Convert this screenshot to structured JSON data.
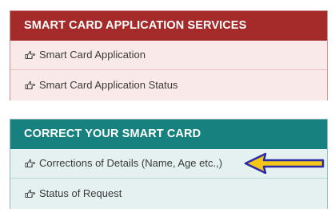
{
  "services_panel": {
    "heading": "SMART CARD APPLICATION SERVICES",
    "heading_color": "#a52a2a",
    "items": [
      {
        "label": "Smart Card Application",
        "icon": "hand-point-right-icon"
      },
      {
        "label": "Smart Card Application Status",
        "icon": "hand-point-right-icon"
      }
    ]
  },
  "correct_panel": {
    "heading": "CORRECT YOUR SMART CARD",
    "heading_color": "#16817e",
    "items": [
      {
        "label": "Corrections of Details (Name, Age etc.,)",
        "icon": "hand-point-right-icon"
      },
      {
        "label": "Status of Request",
        "icon": "hand-point-right-icon"
      }
    ]
  },
  "annotation": {
    "icon": "arrow-left-icon",
    "fill_color": "#f5c518",
    "stroke_color": "#2a2aa8"
  }
}
